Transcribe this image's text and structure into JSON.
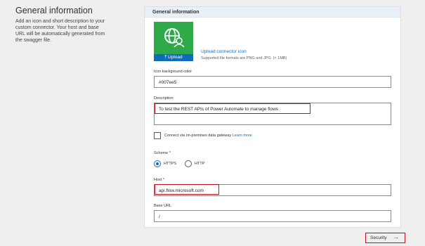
{
  "left": {
    "title": "General information",
    "description": "Add an icon and short description to your custom connector. Your host and base URL will be automatically generated from the swagger file."
  },
  "panel": {
    "header": "General information",
    "icon": {
      "name": "globe-user-icon",
      "background": "#2eaa4a"
    },
    "upload_button": "⤒ Upload",
    "upload_link": "Upload connector icon",
    "upload_hint": "Supported file formats are PNG and JPG. (< 1MB)",
    "icon_bg_label": "Icon background color",
    "icon_bg_value": "#007ee5",
    "description_label": "Description",
    "description_value": "To test the REST APIs of Power Automate to manage flows",
    "gateway_label": "Connect via on-premises data gateway",
    "gateway_link": "Learn more",
    "scheme_label": "Scheme *",
    "scheme_https": "HTTPS",
    "scheme_http": "HTTP",
    "host_label": "Host *",
    "host_value": "api.flow.microsoft.com",
    "baseurl_label": "Base URL",
    "baseurl_value": "/"
  },
  "footer": {
    "security_label": "Security",
    "arrow": "→"
  },
  "colors": {
    "accent": "#0f6cbd",
    "highlight": "#c50f1f",
    "tile": "#2eaa4a"
  }
}
